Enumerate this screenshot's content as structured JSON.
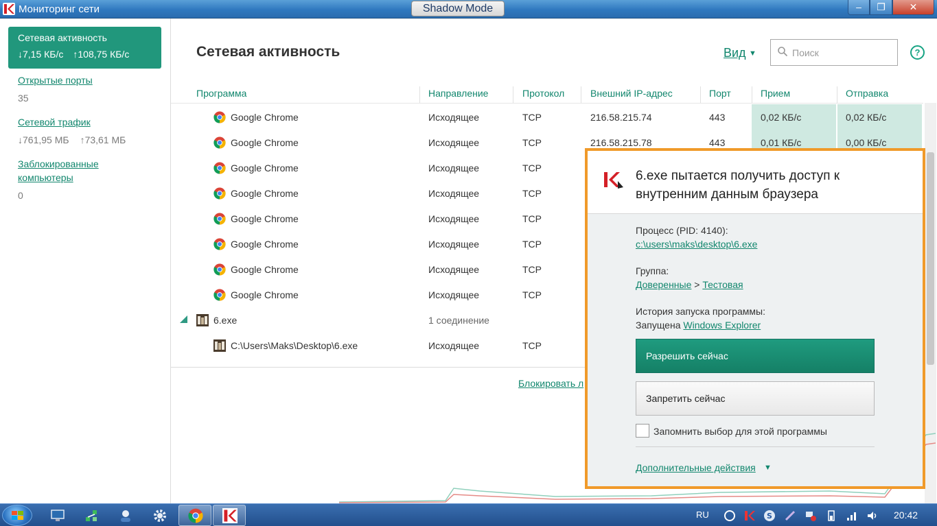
{
  "window": {
    "title": "Мониторинг сети",
    "shadow_mode": "Shadow Mode",
    "minimize": "–",
    "maximize": "❐",
    "close": "✕"
  },
  "sidebar": {
    "active": {
      "title": "Сетевая активность",
      "down": "↓7,15 КБ/с",
      "up": "↑108,75 КБ/с"
    },
    "open_ports": {
      "label": "Открытые порты",
      "value": "35"
    },
    "traffic": {
      "label": "Сетевой трафик",
      "down": "↓761,95 МБ",
      "up": "↑73,61 МБ"
    },
    "blocked": {
      "label": "Заблокированные компьютеры",
      "value": "0"
    }
  },
  "main": {
    "title": "Сетевая активность",
    "view_label": "Вид",
    "search_placeholder": "Поиск",
    "help": "?",
    "columns": [
      "Программа",
      "Направление",
      "Протокол",
      "Внешний IP-адрес",
      "Порт",
      "Прием",
      "Отправка"
    ],
    "rows": [
      {
        "program": "Google Chrome",
        "direction": "Исходящее",
        "protocol": "TCP",
        "ip": "216.58.215.74",
        "port": "443",
        "recv": "0,02 КБ/с",
        "send": "0,02 КБ/с"
      },
      {
        "program": "Google Chrome",
        "direction": "Исходящее",
        "protocol": "TCP",
        "ip": "216.58.215.78",
        "port": "443",
        "recv": "0,01 КБ/с",
        "send": "0,00 КБ/с"
      },
      {
        "program": "Google Chrome",
        "direction": "Исходящее",
        "protocol": "TCP"
      },
      {
        "program": "Google Chrome",
        "direction": "Исходящее",
        "protocol": "TCP"
      },
      {
        "program": "Google Chrome",
        "direction": "Исходящее",
        "protocol": "TCP"
      },
      {
        "program": "Google Chrome",
        "direction": "Исходящее",
        "protocol": "TCP"
      },
      {
        "program": "Google Chrome",
        "direction": "Исходящее",
        "protocol": "TCP"
      },
      {
        "program": "Google Chrome",
        "direction": "Исходящее",
        "protocol": "TCP"
      }
    ],
    "group": {
      "program": "6.exe",
      "connections": "1 соединение"
    },
    "child": {
      "program": "C:\\Users\\Maks\\Desktop\\6.exe",
      "direction": "Исходящее",
      "protocol": "TCP"
    },
    "block_link": "Блокировать л"
  },
  "popup": {
    "title": "6.exe пытается получить доступ к внутренним данным браузера",
    "process_label": "Процесс (PID: 4140):",
    "process_path": "c:\\users\\maks\\desktop\\6.exe",
    "group_label": "Группа:",
    "group_trusted": "Доверенные",
    "group_sep": ">",
    "group_test": "Тестовая",
    "history_label": "История запуска программы:",
    "launched_prefix": "Запущена",
    "launched_by": "Windows Explorer",
    "allow": "Разрешить сейчас",
    "deny": "Запретить сейчас",
    "remember": "Запомнить выбор для этой программы",
    "more": "Дополнительные действия"
  },
  "taskbar": {
    "lang": "RU",
    "time": "20:42"
  },
  "colors": {
    "accent": "#21977c",
    "popup_border": "#f09a2a",
    "highlight": "#cfe9e1"
  }
}
